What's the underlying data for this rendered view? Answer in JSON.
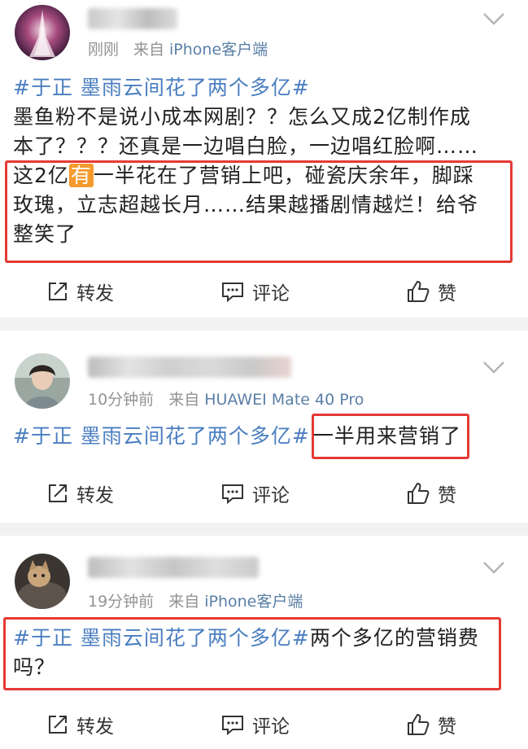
{
  "posts": [
    {
      "meta_time": "刚刚",
      "meta_from": "来自",
      "meta_source": "iPhone客户端",
      "hashtag": "#于正 墨雨云间花了两个多亿#",
      "text_line1": "墨鱼粉不是说小成本网剧？？怎么又成2亿制作成",
      "text_line2": "本了？？？还真是一边唱白脸，一边唱红脸啊……",
      "text_boxed_pre": "这2亿",
      "text_highlight": "有",
      "text_boxed_post1": "一半花在了营销上吧，碰瓷庆余年，脚踩",
      "text_boxed_line2": "玫瑰，立志超越长月……结果越播剧情越烂！给爷",
      "text_boxed_line3": "整笑了"
    },
    {
      "meta_time": "10分钟前",
      "meta_from": "来自",
      "meta_source": "HUAWEI Mate 40 Pro",
      "hashtag": "#于正 墨雨云间花了两个多亿#",
      "text_boxed": "一半用来营销了"
    },
    {
      "meta_time": "19分钟前",
      "meta_from": "来自",
      "meta_source": "iPhone客户端",
      "hashtag": "#于正 墨雨云间花了两个多亿#",
      "text_after": "两个多亿的营销费",
      "text_line2": "吗？"
    }
  ],
  "actions": {
    "repost": "转发",
    "comment": "评论",
    "like": "赞"
  },
  "colors": {
    "hashtag": "#4a7ec0",
    "source": "#5b7fa6",
    "highlight": "#f59a2c",
    "annotation_box": "#e53935",
    "divider": "#f2f2f2"
  },
  "icons": [
    "repost-icon",
    "comment-icon",
    "like-icon",
    "chevron-down-icon",
    "avatar"
  ]
}
